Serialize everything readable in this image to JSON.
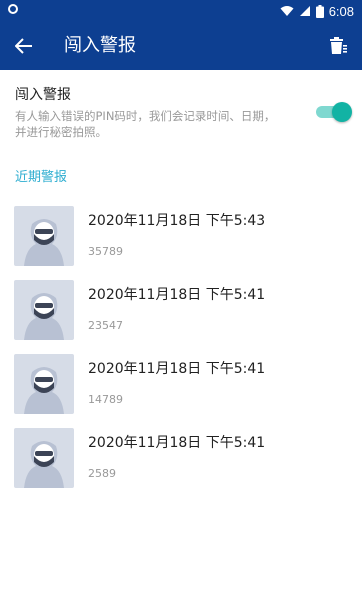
{
  "status_bar": {
    "time": "6:08"
  },
  "app_bar": {
    "title": "闯入警报"
  },
  "setting": {
    "title": "闯入警报",
    "description": "有人输入错误的PIN码时，我们会记录时间、日期，并进行秘密拍照。",
    "enabled": true
  },
  "section_label": "近期警报",
  "alerts": [
    {
      "time": "2020年11月18日 下午5:43",
      "pin": "35789"
    },
    {
      "time": "2020年11月18日 下午5:41",
      "pin": "23547"
    },
    {
      "time": "2020年11月18日 下午5:41",
      "pin": "14789"
    },
    {
      "time": "2020年11月18日 下午5:41",
      "pin": "2589"
    }
  ],
  "colors": {
    "appbar": "#0d3f91",
    "accent": "#12b3a4",
    "section": "#2dadd0"
  }
}
